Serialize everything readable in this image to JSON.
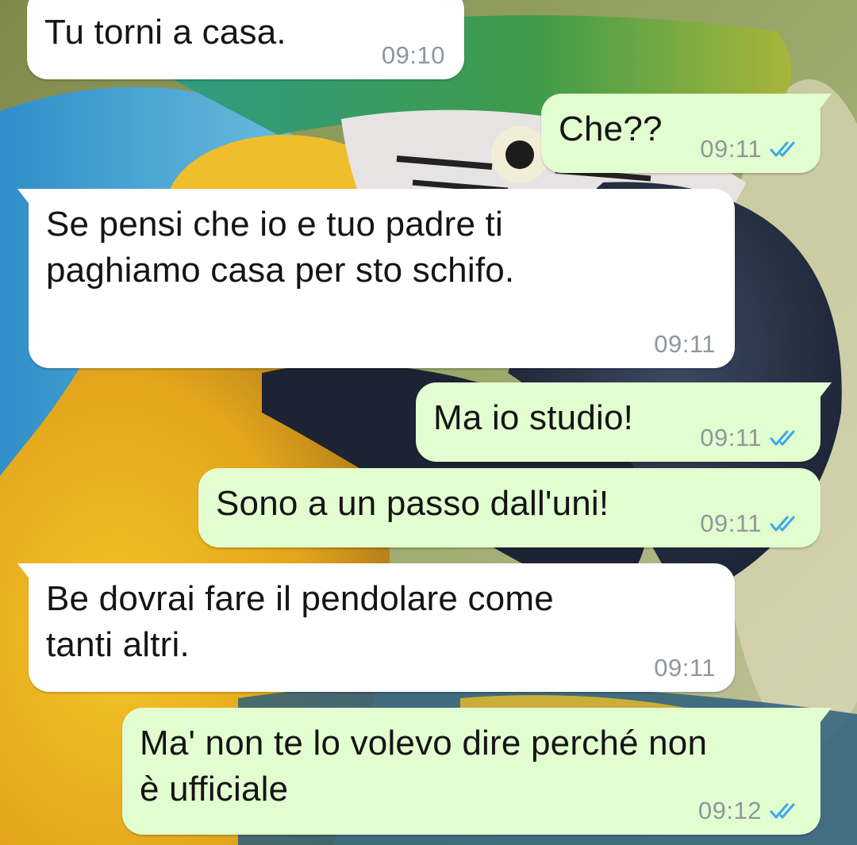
{
  "chat": {
    "read_tick_color": "#3aa8e8",
    "messages": [
      {
        "direction": "incoming",
        "text": "Tu torni a casa.",
        "time": "09:10"
      },
      {
        "direction": "outgoing",
        "text": "Che??",
        "time": "09:11",
        "status": "read"
      },
      {
        "direction": "incoming",
        "text": "Se pensi che io e tuo padre ti\npaghiamo casa per sto schifo.",
        "time": "09:11"
      },
      {
        "direction": "outgoing",
        "text": "Ma io studio!",
        "time": "09:11",
        "status": "read"
      },
      {
        "direction": "outgoing",
        "text": "Sono a un passo dall'uni!",
        "time": "09:11",
        "status": "read"
      },
      {
        "direction": "incoming",
        "text": "Be dovrai fare il pendolare come\ntanti altri.",
        "time": "09:11"
      },
      {
        "direction": "outgoing",
        "text": "Ma' non te lo volevo dire perché non\nè ufficiale",
        "time": "09:12",
        "status": "read"
      }
    ]
  },
  "colors": {
    "incoming_bubble": "#ffffff",
    "outgoing_bubble": "#e2fdd0",
    "timestamp": "#8f979b"
  },
  "wallpaper": {
    "icon": "macaw-parrot-photo"
  }
}
